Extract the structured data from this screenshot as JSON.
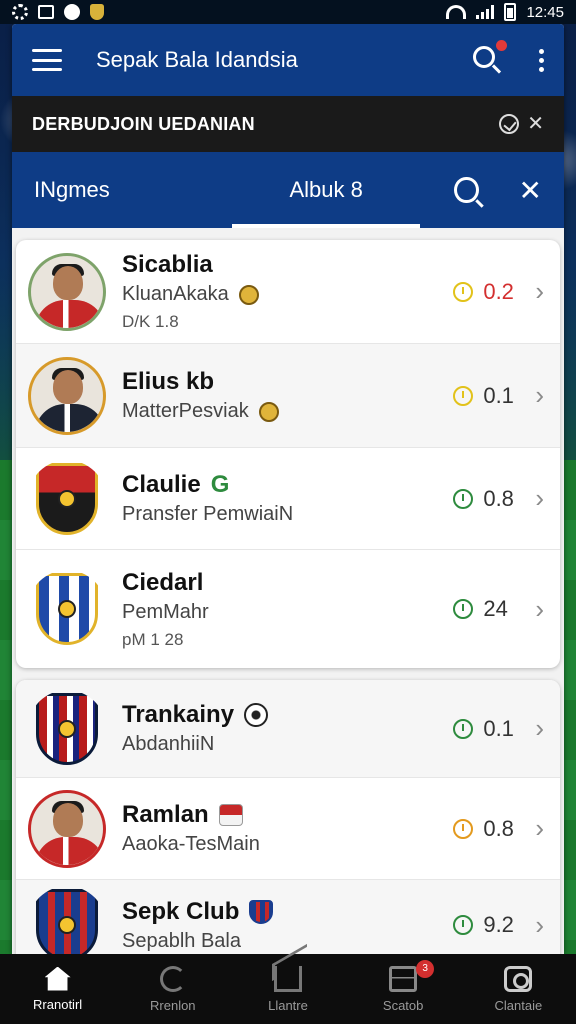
{
  "status_bar": {
    "time": "12:45"
  },
  "app_bar": {
    "title": "Sepak Bala Idandsia"
  },
  "banner": {
    "text": "DERBUDJOIN UEDANIAN"
  },
  "tabs": {
    "left": "INgmes",
    "center": "Albuk 8"
  },
  "items": [
    {
      "name": "Sicablia",
      "subtitle": "KluanAkaka",
      "meta": "D/K 1.8",
      "score": "0.2",
      "clock": "yellow",
      "score_color": "red"
    },
    {
      "name": "Elius kb",
      "subtitle": "MatterPesviak",
      "meta": "",
      "score": "0.1",
      "clock": "yellow",
      "score_color": "normal"
    },
    {
      "name": "Claulie",
      "name_extra": "G",
      "subtitle": "Pransfer PemwiaiN",
      "meta": "",
      "score": "0.8",
      "clock": "green",
      "score_color": "normal"
    },
    {
      "name": "Ciedarl",
      "subtitle": "PemMahr",
      "meta": "pM 1 28",
      "score": "24",
      "clock": "green",
      "score_color": "normal"
    },
    {
      "name": "Trankainy",
      "subtitle": "AbdanhiiN",
      "meta": "",
      "score": "0.1",
      "clock": "green",
      "score_color": "normal"
    },
    {
      "name": "Ramlan",
      "subtitle": "Aaoka-TesMain",
      "meta": "",
      "score": "0.8",
      "clock": "orange",
      "score_color": "normal"
    },
    {
      "name": "Sepk Club",
      "subtitle": "Sepablh Bala",
      "meta": "",
      "score": "9.2",
      "clock": "green",
      "score_color": "normal"
    }
  ],
  "bottom_nav": [
    {
      "label": "Rranotirl",
      "icon": "home-icon"
    },
    {
      "label": "Rrenlon",
      "icon": "refresh-icon"
    },
    {
      "label": "Llantre",
      "icon": "house-outline-icon"
    },
    {
      "label": "Scatob",
      "icon": "inbox-icon",
      "badge": "3"
    },
    {
      "label": "Clantaie",
      "icon": "camera-icon"
    }
  ]
}
